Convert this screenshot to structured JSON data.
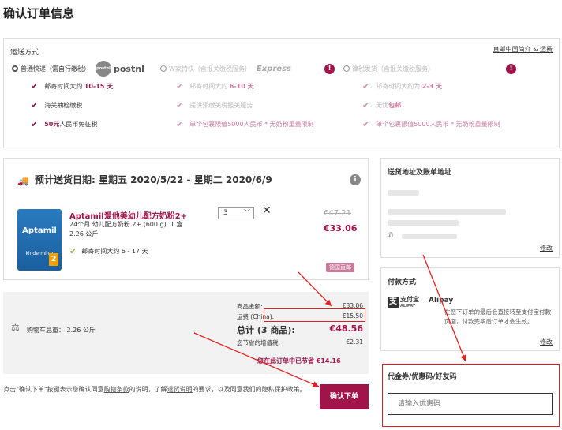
{
  "page_title": "确认订单信息",
  "shipping": {
    "heading": "运送方式",
    "link": "直邮中国简介 & 运费",
    "options": [
      {
        "label": "普通快递（需自行缴税）",
        "carrier": "postnl",
        "carrier_badge": "postnl",
        "selected": true
      },
      {
        "label": "W家特快（含报关缴税服务）",
        "carrier": "Express",
        "selected": false
      },
      {
        "label": "律税发货（含报关缴税服务）",
        "carrier": "",
        "selected": false
      }
    ],
    "features": [
      [
        {
          "text": "邮寄时间大约 ",
          "bold": "10-15 天"
        },
        {
          "text": "海关抽检缴税",
          "bold": ""
        },
        {
          "text": "人民币免征税",
          "bold": "50元"
        }
      ],
      [
        {
          "text": "邮寄时间大约 ",
          "bold": "6-10 天"
        },
        {
          "text": "提供预缴关税报关服务",
          "bold": ""
        },
        {
          "text": "单个包裹限值5000人民币 * 无奶粉重量限制",
          "bold": ""
        }
      ],
      [
        {
          "text": "邮寄时间大约为 ",
          "bold": "2-3 天"
        },
        {
          "text": "无忧",
          "bold": "包邮"
        },
        {
          "text": "单个包裹限值5000人民币 * 无奶粉重量限制",
          "bold": ""
        }
      ]
    ]
  },
  "order": {
    "delivery_date": "预计送货日期: 星期五 2020/5/22 - 星期二 2020/6/9",
    "product": {
      "name": "Aptamil爱他美幼儿配方奶粉2+",
      "desc": "24个月 幼儿配方奶粉 2+ (600 g), 1 盒",
      "weight": "2.26 公斤",
      "ship_time": "邮寄时间大约 6 - 17 天",
      "qty": "3",
      "price_old": "€47.21",
      "price_new": "€33.06",
      "badge": "德国直邮",
      "img_label": "Aptamil",
      "img_sub": "kindermilch",
      "img_stage": "2"
    }
  },
  "summary": {
    "cart_weight": "购物车总重：  2.26 公斤",
    "rows": [
      {
        "label": "商品金额:",
        "value": "€33.06"
      },
      {
        "label": "运费 (China):",
        "value": "€15.50"
      }
    ],
    "total_label": "总计 (3 商品):",
    "total_value": "€48.56",
    "vat_label": "您节省的增值税:",
    "vat_value": "€2.31",
    "saved": "您在此订单中已节省 €14.16"
  },
  "terms": {
    "p1": "点击\"确认下单\"按键表示您确认同意",
    "l1": "购物条款",
    "p2": "的说明，了解",
    "l2": "退货说明",
    "p3": "的要求，以及同意我们的隐私保护政策。"
  },
  "submit_label": "确认下单",
  "address": {
    "title": "送货地址及账单地址",
    "edit": "修改"
  },
  "payment": {
    "title": "付款方式",
    "logo_cn": "支付宝",
    "logo_en": "ALIPAY",
    "name": "Alipay",
    "desc": "在您下订单的最后会直接转至支付宝付款页面，付款完毕后订单才会生效。",
    "edit": "修改"
  },
  "coupon": {
    "title": "代金券/优惠码/好友码",
    "placeholder": "请输入优惠码"
  },
  "colors": {
    "brand": "#a0144a",
    "highlight": "#e02020"
  }
}
